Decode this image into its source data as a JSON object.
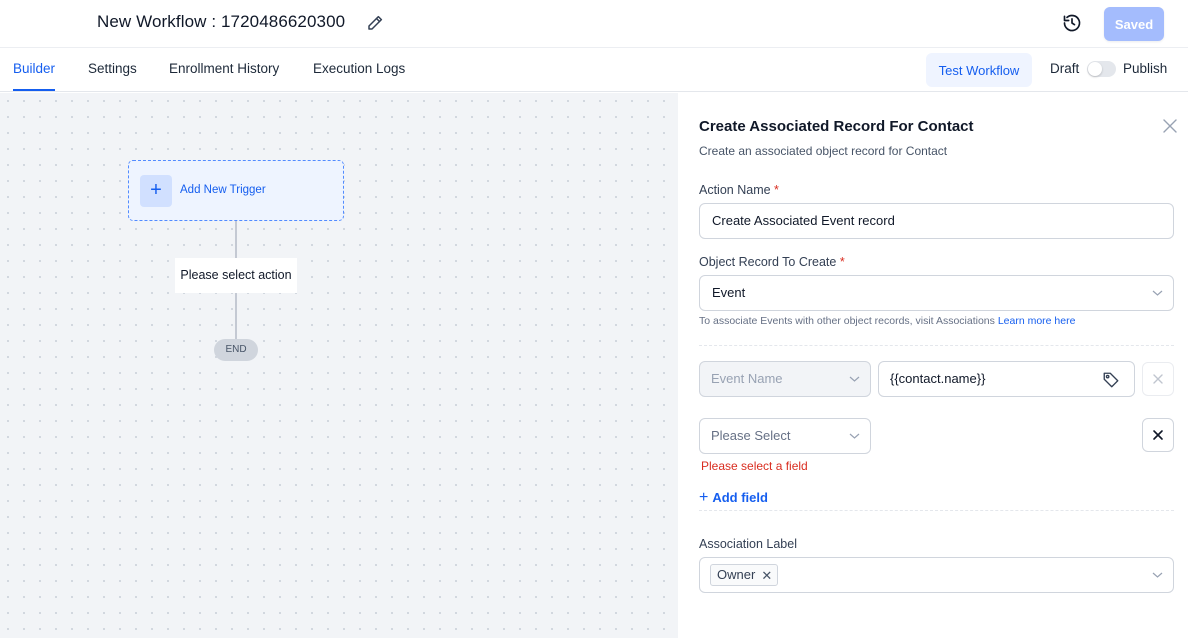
{
  "header": {
    "title": "New Workflow : 1720486620300",
    "saved_label": "Saved",
    "icons": {
      "edit": "pencil-icon",
      "history": "history-icon"
    }
  },
  "tabs": [
    {
      "label": "Builder",
      "active": true
    },
    {
      "label": "Settings",
      "active": false
    },
    {
      "label": "Enrollment History",
      "active": false
    },
    {
      "label": "Execution Logs",
      "active": false
    }
  ],
  "toolbar": {
    "test_label": "Test Workflow",
    "draft_label": "Draft",
    "publish_label": "Publish",
    "published": false
  },
  "canvas": {
    "trigger_label": "Add New Trigger",
    "action_label": "Please select action",
    "end_label": "END"
  },
  "panel": {
    "title": "Create Associated Record For Contact",
    "subtitle": "Create an associated object record for Contact",
    "action_name_label": "Action Name",
    "required_mark": "*",
    "action_name_value": "Create Associated Event record",
    "object_label": "Object Record To Create",
    "object_value": "Event",
    "hint_text": "To associate Events with other object records, visit Associations",
    "hint_link": "Learn more here",
    "fields": [
      {
        "field": "Event Name",
        "value": "{{contact.name}}",
        "disabled": true
      },
      {
        "field": "Please Select",
        "value": "",
        "disabled": false
      }
    ],
    "error_text": "Please select a field",
    "add_field_label": "Add field",
    "association_label": "Association Label",
    "association_chip": "Owner"
  },
  "colors": {
    "accent": "#155eef",
    "saved_button": "#a4bcfd",
    "error": "#d92d20",
    "trigger_border": "#528bff"
  }
}
